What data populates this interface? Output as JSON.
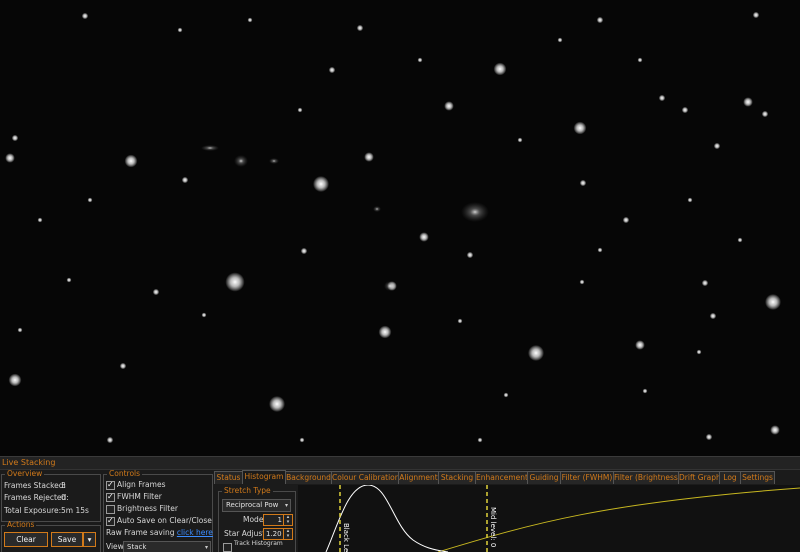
{
  "window": {
    "title": "Live Stacking"
  },
  "overview": {
    "legend": "Overview",
    "frames_stacked_label": "Frames Stacked:",
    "frames_stacked": "3",
    "frames_rejected_label": "Frames Rejected:",
    "frames_rejected": "0",
    "total_exposure_label": "Total Exposure:",
    "total_exposure": "5m 15s"
  },
  "actions": {
    "legend": "Actions",
    "clear_label": "Clear",
    "save_label": "Save",
    "save_menu_icon": "dropdown-arrow"
  },
  "controls": {
    "legend": "Controls",
    "align_frames": {
      "label": "Align Frames",
      "checked": true
    },
    "fwhm_filter": {
      "label": "FWHM Filter",
      "checked": true
    },
    "brightness_filter": {
      "label": "Brightness Filter",
      "checked": false
    },
    "auto_save": {
      "label": "Auto Save on Clear/Close",
      "checked": true
    },
    "raw_frame_label": "Raw Frame saving",
    "raw_frame_link": "click here",
    "view_label": "View",
    "view_value": "Stack"
  },
  "tabs": [
    "Status",
    "Histogram",
    "Background",
    "Colour Calibration",
    "Alignment",
    "Stacking",
    "Enhancement",
    "Guiding",
    "Filter (FWHM)",
    "Filter (Brightness)",
    "Drift Graph",
    "Log",
    "Settings"
  ],
  "active_tab": "Histogram",
  "stretch": {
    "legend": "Stretch Type",
    "type_value": "Reciprocal Pow",
    "mode_label": "Mode",
    "mode_value": "1",
    "star_adjust_label": "Star Adjust",
    "star_adjust_value": "1.20",
    "track_histogram_label": "Track Histogram"
  },
  "histogram": {
    "black_level_label": "Black Level",
    "mid_level_label": "Mid level: 0",
    "marker_color": "#e0d23a",
    "curve_color": "#c8b820",
    "hist_color": "#ffffff"
  },
  "colors": {
    "accent": "#d27a1a",
    "link": "#3b8cff"
  },
  "icons": {
    "check": "checkmark-icon",
    "spin_up": "up-arrow",
    "spin_down": "down-arrow"
  }
}
